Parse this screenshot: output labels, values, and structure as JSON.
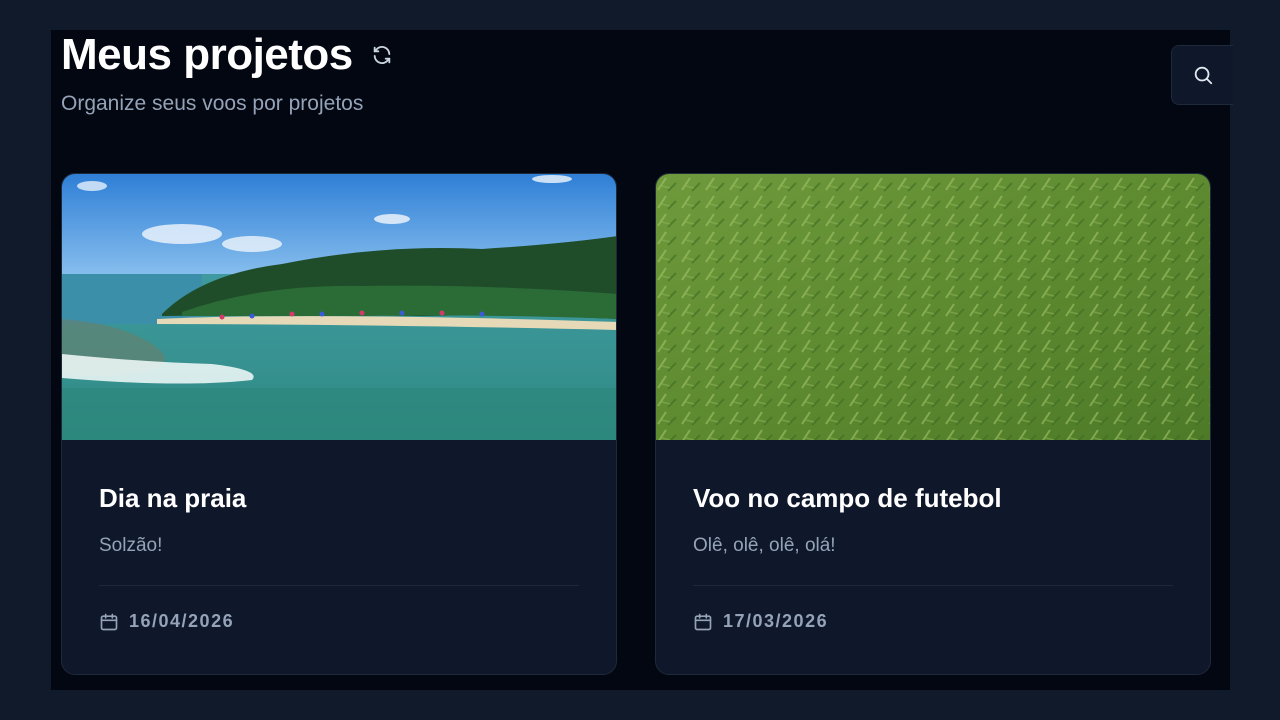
{
  "header": {
    "title": "Meus projetos",
    "subtitle": "Organize seus voos por projetos",
    "refresh_icon": "refresh-icon",
    "search_icon": "search-icon"
  },
  "projects": [
    {
      "title": "Dia na praia",
      "description": "Solzão!",
      "date": "16/04/2026",
      "image": "beach-aerial-photo",
      "date_icon": "calendar-icon"
    },
    {
      "title": "Voo no campo de futebol",
      "description": "Olê, olê, olê, olá!",
      "date": "17/03/2026",
      "image": "grass-field-photo",
      "date_icon": "calendar-icon"
    }
  ],
  "colors": {
    "background": "#111a2b",
    "panel": "#030711",
    "card": "#0f172a",
    "muted_text": "#94a3b8"
  }
}
